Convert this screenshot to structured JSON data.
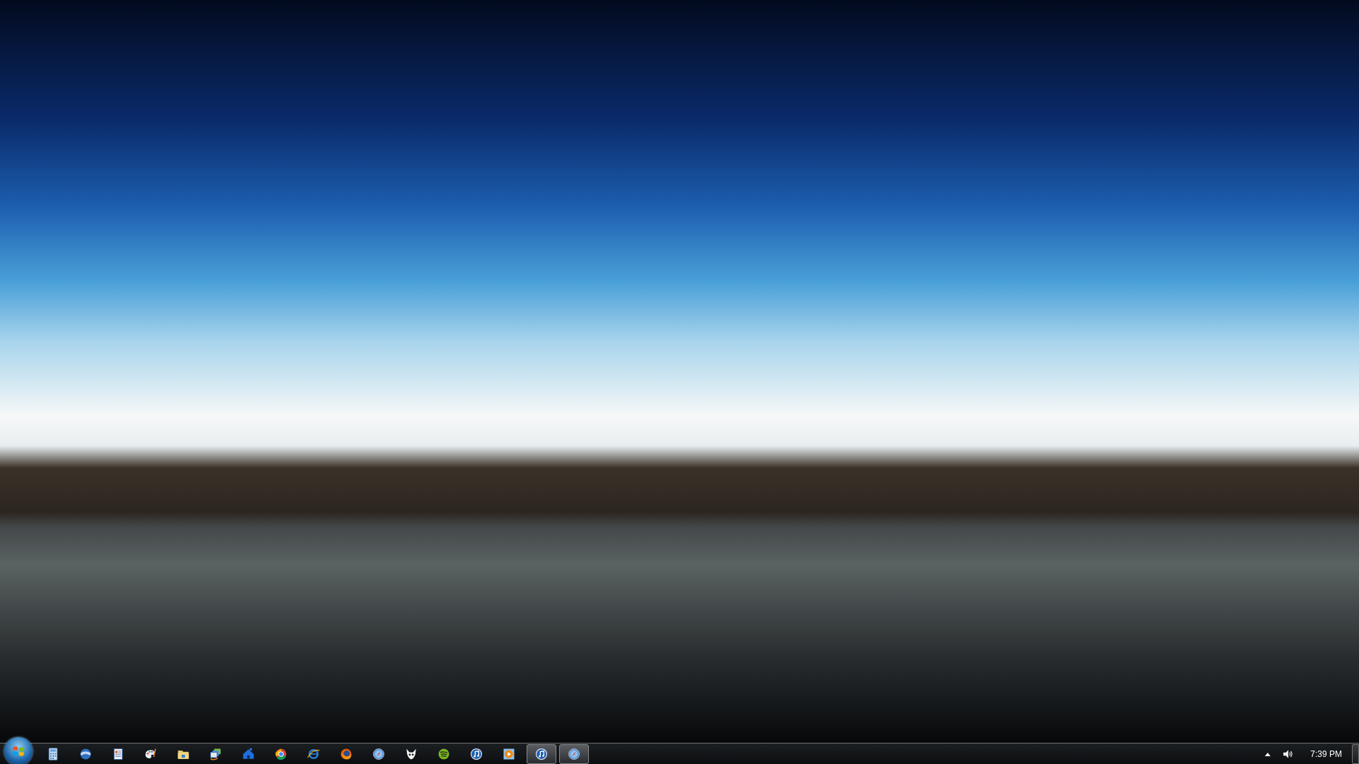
{
  "taskbar": {
    "pinned": [
      {
        "kind": "calculator",
        "running": false
      },
      {
        "kind": "globe",
        "running": false
      },
      {
        "kind": "document",
        "running": false
      },
      {
        "kind": "palette",
        "running": false
      },
      {
        "kind": "folder",
        "running": false
      },
      {
        "kind": "monitor",
        "running": false
      },
      {
        "kind": "house",
        "running": false
      },
      {
        "kind": "ring",
        "running": false
      },
      {
        "kind": "swirl",
        "running": false
      },
      {
        "kind": "fox",
        "running": false
      },
      {
        "kind": "compass",
        "running": false
      },
      {
        "kind": "mask",
        "running": false
      },
      {
        "kind": "waves",
        "running": false
      },
      {
        "kind": "note",
        "running": false
      },
      {
        "kind": "play",
        "running": false
      },
      {
        "kind": "note",
        "running": true
      },
      {
        "kind": "compass",
        "running": true
      }
    ],
    "clock": "7:39 PM"
  }
}
